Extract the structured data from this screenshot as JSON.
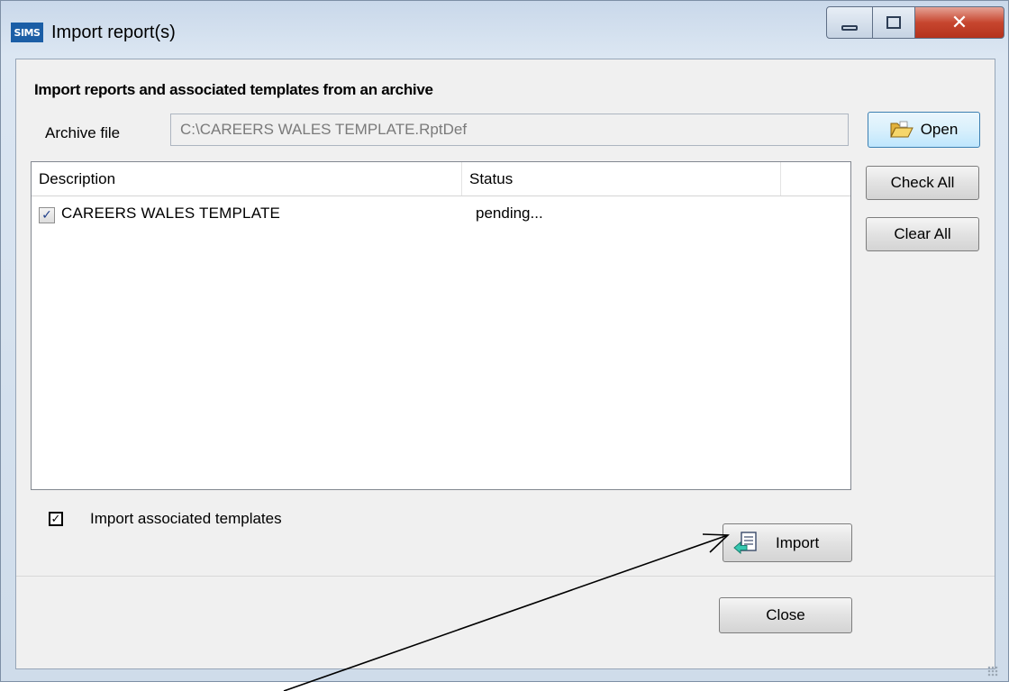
{
  "window": {
    "app_icon_text": "SIMS",
    "title": "Import report(s)"
  },
  "section": {
    "heading": "Import reports and associated templates from an archive"
  },
  "archive": {
    "label": "Archive file",
    "value": "C:\\CAREERS WALES TEMPLATE.RptDef"
  },
  "buttons": {
    "open": "Open",
    "check_all": "Check All",
    "clear_all": "Clear All",
    "import": "Import",
    "close": "Close"
  },
  "list": {
    "columns": [
      "Description",
      "Status",
      ""
    ],
    "rows": [
      {
        "checked": true,
        "description": "CAREERS WALES TEMPLATE",
        "status": "pending..."
      }
    ]
  },
  "options": {
    "import_templates_checked": true,
    "import_templates_label": "Import associated templates"
  },
  "icons": {
    "open": "folder-open-icon",
    "import": "import-document-icon",
    "minimize": "minimize-icon",
    "maximize": "maximize-icon",
    "close": "close-icon"
  },
  "colors": {
    "title_close_red": "#c7462f",
    "app_icon_blue": "#1b5ea6",
    "open_button_blue": "#3c7fb1"
  }
}
